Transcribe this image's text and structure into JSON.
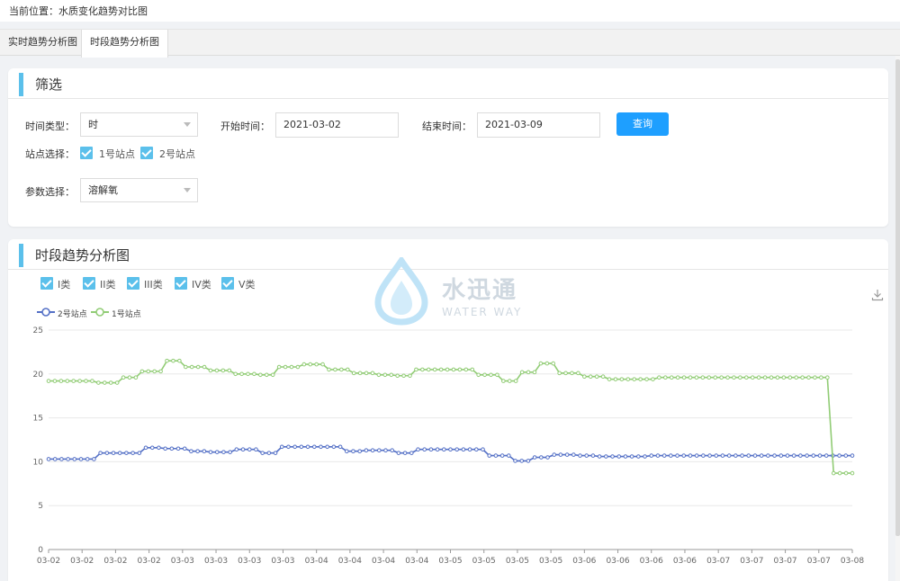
{
  "breadcrumb": "当前位置：水质变化趋势对比图",
  "tabs": [
    {
      "label": "实时趋势分析图",
      "active": false
    },
    {
      "label": "时段趋势分析图",
      "active": true
    }
  ],
  "filter": {
    "title": "筛选",
    "time_type_label": "时间类型：",
    "time_type_value": "时",
    "start_label": "开始时间：",
    "start_value": "2021-03-02",
    "end_label": "结束时间：",
    "end_value": "2021-03-09",
    "query_button": "查询",
    "station_label": "站点选择：",
    "stations": [
      "1号站点",
      "2号站点"
    ],
    "param_label": "参数选择：",
    "param_value": "溶解氧"
  },
  "chart_panel": {
    "title": "时段趋势分析图",
    "classes": [
      "I类",
      "II类",
      "III类",
      "IV类",
      "V类"
    ],
    "watermark_cn": "水迅通",
    "watermark_en": "WATER WAY",
    "download_icon": "download-icon"
  },
  "colors": {
    "accent": "#5bc0eb",
    "button": "#1e9fff",
    "series_2": "#5470c6",
    "series_1": "#91cc75"
  },
  "chart_data": {
    "type": "line",
    "ylim": [
      0,
      25
    ],
    "yticks": [
      "0",
      "5",
      "10",
      "15",
      "20",
      "25"
    ],
    "xticks": [
      "03-02",
      "03-02",
      "03-02",
      "03-02",
      "03-03",
      "03-03",
      "03-03",
      "03-03",
      "03-04",
      "03-04",
      "03-04",
      "03-04",
      "03-05",
      "03-05",
      "03-05",
      "03-05",
      "03-06",
      "03-06",
      "03-06",
      "03-06",
      "03-07",
      "03-07",
      "03-07",
      "03-07",
      "03-08"
    ],
    "legend": [
      "2号站点",
      "1号站点"
    ],
    "series": [
      {
        "name": "2号站点",
        "values": [
          10.3,
          10.3,
          10.3,
          10.3,
          10.3,
          10.3,
          10.3,
          10.3,
          11.0,
          11.0,
          11.0,
          11.0,
          11.0,
          11.0,
          11.0,
          11.6,
          11.6,
          11.6,
          11.5,
          11.5,
          11.5,
          11.5,
          11.2,
          11.2,
          11.2,
          11.1,
          11.1,
          11.1,
          11.1,
          11.4,
          11.4,
          11.4,
          11.4,
          11.0,
          11.0,
          11.0,
          11.7,
          11.7,
          11.7,
          11.7,
          11.7,
          11.7,
          11.7,
          11.7,
          11.7,
          11.7,
          11.2,
          11.2,
          11.2,
          11.3,
          11.3,
          11.3,
          11.3,
          11.3,
          11.0,
          11.0,
          11.0,
          11.4,
          11.4,
          11.4,
          11.4,
          11.4,
          11.4,
          11.4,
          11.4,
          11.4,
          11.4,
          11.4,
          10.7,
          10.7,
          10.7,
          10.7,
          10.1,
          10.1,
          10.1,
          10.5,
          10.5,
          10.5,
          10.8,
          10.8,
          10.8,
          10.8,
          10.7,
          10.7,
          10.7,
          10.6,
          10.6,
          10.6,
          10.6,
          10.6,
          10.6,
          10.6,
          10.6,
          10.7,
          10.7,
          10.7,
          10.7,
          10.7,
          10.7,
          10.7,
          10.7,
          10.7,
          10.7,
          10.7,
          10.7,
          10.7,
          10.7,
          10.7,
          10.7,
          10.7,
          10.7,
          10.7,
          10.7,
          10.7,
          10.7,
          10.7,
          10.7,
          10.7,
          10.7,
          10.7,
          10.7,
          10.7,
          10.7,
          10.7,
          10.7
        ]
      },
      {
        "name": "1号站点",
        "values": [
          19.2,
          19.2,
          19.2,
          19.2,
          19.2,
          19.2,
          19.2,
          19.2,
          19.0,
          19.0,
          19.0,
          19.0,
          19.6,
          19.6,
          19.6,
          20.3,
          20.3,
          20.3,
          20.3,
          21.5,
          21.5,
          21.5,
          20.8,
          20.8,
          20.8,
          20.8,
          20.4,
          20.4,
          20.4,
          20.4,
          20.0,
          20.0,
          20.0,
          20.0,
          19.9,
          19.9,
          19.9,
          20.8,
          20.8,
          20.8,
          20.8,
          21.1,
          21.1,
          21.1,
          21.1,
          20.5,
          20.5,
          20.5,
          20.5,
          20.1,
          20.1,
          20.1,
          20.1,
          19.9,
          19.9,
          19.9,
          19.8,
          19.8,
          19.8,
          20.5,
          20.5,
          20.5,
          20.5,
          20.5,
          20.5,
          20.5,
          20.5,
          20.5,
          20.5,
          19.9,
          19.9,
          19.9,
          19.9,
          19.2,
          19.2,
          19.2,
          20.2,
          20.2,
          20.2,
          21.2,
          21.2,
          21.2,
          20.1,
          20.1,
          20.1,
          20.1,
          19.7,
          19.7,
          19.7,
          19.7,
          19.4,
          19.4,
          19.4,
          19.4,
          19.4,
          19.4,
          19.4,
          19.4,
          19.6,
          19.6,
          19.6,
          19.6,
          19.6,
          19.6,
          19.6,
          19.6,
          19.6,
          19.6,
          19.6,
          19.6,
          19.6,
          19.6,
          19.6,
          19.6,
          19.6,
          19.6,
          19.6,
          19.6,
          19.6,
          19.6,
          19.6,
          19.6,
          19.6,
          19.6,
          19.6,
          19.6,
          8.7,
          8.7,
          8.7,
          8.7
        ]
      }
    ]
  }
}
